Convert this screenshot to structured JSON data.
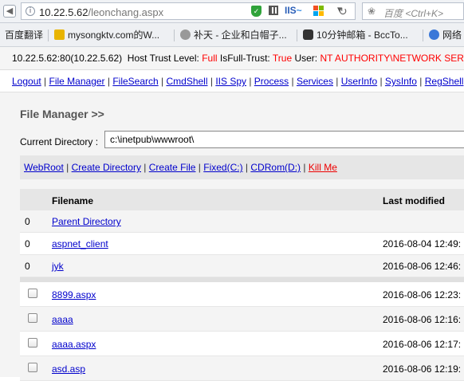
{
  "browser": {
    "url_host": "10.22.5.62",
    "url_path": "/leonchang.aspx",
    "iis_label": "IIS",
    "search_placeholder": "百度 <Ctrl+K>",
    "bookmarks": [
      {
        "label": "百度翻译",
        "icon": "blue-flag",
        "color": "#3c6fd8"
      },
      {
        "label": "mysongktv.com的W...",
        "icon": "yellow-cross",
        "color": "#e8b400"
      },
      {
        "label": "补天 - 企业和白帽子...",
        "icon": "gear-star",
        "color": "#888888"
      },
      {
        "label": "10分钟邮箱 - BccTo...",
        "icon": "camera",
        "color": "#333333"
      },
      {
        "label": "网络",
        "icon": "info-circle",
        "color": "#3b78d8"
      }
    ]
  },
  "host_bar": {
    "address": "10.22.5.62:80(10.22.5.62)",
    "trust_label": "Host Trust Level:",
    "trust_value": "Full",
    "isfull_label": "IsFull-Trust:",
    "isfull_value": "True",
    "user_label": "User:",
    "user_value": "NT AUTHORITY\\NETWORK SERVICE"
  },
  "nav": [
    "Logout",
    "File Manager",
    "FileSearch",
    "CmdShell",
    "IIS Spy",
    "Process",
    "Services",
    "UserInfo",
    "SysInfo",
    "RegShell"
  ],
  "page": {
    "title": "File Manager >>",
    "current_directory_label": "Current Directory :",
    "current_directory_value": "c:\\inetpub\\wwwroot\\"
  },
  "actions": [
    {
      "label": "WebRoot",
      "color": "#0000cc"
    },
    {
      "label": "Create Directory",
      "color": "#0000cc"
    },
    {
      "label": "Create File",
      "color": "#0000cc"
    },
    {
      "label": "Fixed(C:)",
      "color": "#0000cc"
    },
    {
      "label": "CDRom(D:)",
      "color": "#0000cc"
    },
    {
      "label": "Kill Me",
      "color": "#ee0000"
    }
  ],
  "table": {
    "headers": {
      "filename": "Filename",
      "last_modified": "Last modified"
    },
    "dirs": [
      {
        "count": "0",
        "name": "Parent Directory",
        "modified": ""
      },
      {
        "count": "0",
        "name": "aspnet_client",
        "modified": "2016-08-04 12:49:"
      },
      {
        "count": "0",
        "name": "jyk",
        "modified": "2016-08-06 12:46:"
      }
    ],
    "files": [
      {
        "name": "8899.aspx",
        "modified": "2016-08-06 12:23:"
      },
      {
        "name": "aaaa",
        "modified": "2016-08-06 12:16:"
      },
      {
        "name": "aaaa.aspx",
        "modified": "2016-08-06 12:17:"
      },
      {
        "name": "asd.asp",
        "modified": "2016-08-06 12:19:"
      }
    ]
  }
}
